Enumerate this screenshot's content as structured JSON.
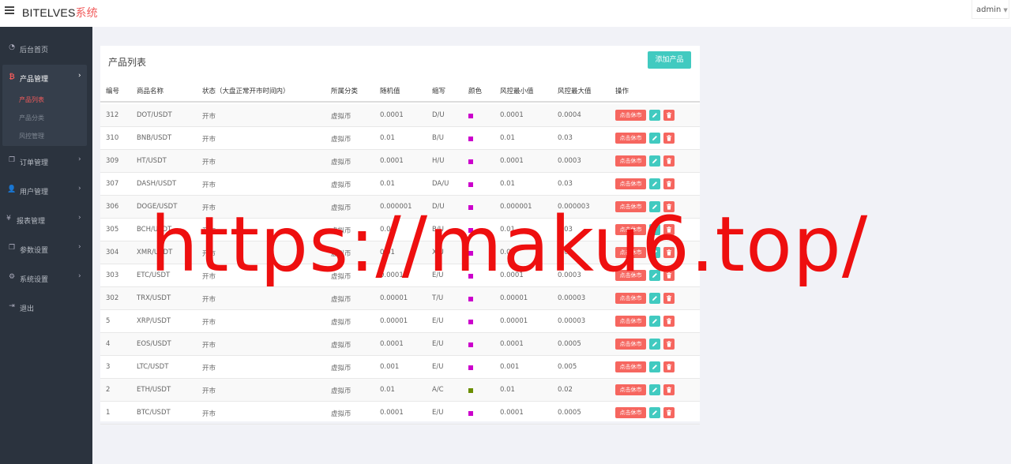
{
  "header": {
    "brand_main": "BITELVES",
    "brand_suffix": "系统",
    "user": "admin"
  },
  "sidebar": {
    "items": [
      {
        "label": "后台首页",
        "icon": "dashboard-icon"
      },
      {
        "label": "产品管理",
        "icon": "bitcoin-icon"
      },
      {
        "label": "订单管理",
        "icon": "copy-icon"
      },
      {
        "label": "用户管理",
        "icon": "user-icon"
      },
      {
        "label": "报表管理",
        "icon": "yen-icon"
      },
      {
        "label": "参数设置",
        "icon": "copy-icon"
      },
      {
        "label": "系统设置",
        "icon": "cogs-icon"
      },
      {
        "label": "退出",
        "icon": "sign-out-icon"
      }
    ],
    "sub_items": [
      {
        "label": "产品列表"
      },
      {
        "label": "产品分类"
      },
      {
        "label": "风控管理"
      }
    ]
  },
  "panel": {
    "title": "产品列表",
    "add_button": "添加产品"
  },
  "table": {
    "headers": [
      "编号",
      "商品名称",
      "状态（大盘正常开市时间内）",
      "所属分类",
      "随机值",
      "缩写",
      "颜色",
      "风控最小值",
      "风控最大值",
      "操作"
    ],
    "halt_label": "点击休市",
    "rows": [
      {
        "id": "312",
        "name": "DOT/USDT",
        "status": "开市",
        "category": "虚拟币",
        "random": "0.0001",
        "code": "D/U",
        "color": "#cc00cc",
        "min": "0.0001",
        "max": "0.0004"
      },
      {
        "id": "310",
        "name": "BNB/USDT",
        "status": "开市",
        "category": "虚拟币",
        "random": "0.01",
        "code": "B/U",
        "color": "#cc00cc",
        "min": "0.01",
        "max": "0.03"
      },
      {
        "id": "309",
        "name": "HT/USDT",
        "status": "开市",
        "category": "虚拟币",
        "random": "0.0001",
        "code": "H/U",
        "color": "#cc00cc",
        "min": "0.0001",
        "max": "0.0003"
      },
      {
        "id": "307",
        "name": "DASH/USDT",
        "status": "开市",
        "category": "虚拟币",
        "random": "0.01",
        "code": "DA/U",
        "color": "#cc00cc",
        "min": "0.01",
        "max": "0.03"
      },
      {
        "id": "306",
        "name": "DOGE/USDT",
        "status": "开市",
        "category": "虚拟币",
        "random": "0.000001",
        "code": "D/U",
        "color": "#cc00cc",
        "min": "0.000001",
        "max": "0.000003"
      },
      {
        "id": "305",
        "name": "BCH/USDT",
        "status": "开市",
        "category": "虚拟币",
        "random": "0.01",
        "code": "B/U",
        "color": "#cc00cc",
        "min": "0.01",
        "max": "0.03"
      },
      {
        "id": "304",
        "name": "XMR/USDT",
        "status": "开市",
        "category": "虚拟币",
        "random": "0.01",
        "code": "X/U",
        "color": "#cc00cc",
        "min": "0.01",
        "max": "0.03"
      },
      {
        "id": "303",
        "name": "ETC/USDT",
        "status": "开市",
        "category": "虚拟币",
        "random": "0.0001",
        "code": "E/U",
        "color": "#cc00cc",
        "min": "0.0001",
        "max": "0.0003"
      },
      {
        "id": "302",
        "name": "TRX/USDT",
        "status": "开市",
        "category": "虚拟币",
        "random": "0.00001",
        "code": "T/U",
        "color": "#cc00cc",
        "min": "0.00001",
        "max": "0.00003"
      },
      {
        "id": "5",
        "name": "XRP/USDT",
        "status": "开市",
        "category": "虚拟币",
        "random": "0.00001",
        "code": "E/U",
        "color": "#cc00cc",
        "min": "0.00001",
        "max": "0.00003"
      },
      {
        "id": "4",
        "name": "EOS/USDT",
        "status": "开市",
        "category": "虚拟币",
        "random": "0.0001",
        "code": "E/U",
        "color": "#cc00cc",
        "min": "0.0001",
        "max": "0.0005"
      },
      {
        "id": "3",
        "name": "LTC/USDT",
        "status": "开市",
        "category": "虚拟币",
        "random": "0.001",
        "code": "E/U",
        "color": "#cc00cc",
        "min": "0.001",
        "max": "0.005"
      },
      {
        "id": "2",
        "name": "ETH/USDT",
        "status": "开市",
        "category": "虚拟币",
        "random": "0.01",
        "code": "A/C",
        "color": "#6b8e00",
        "min": "0.01",
        "max": "0.02"
      },
      {
        "id": "1",
        "name": "BTC/USDT",
        "status": "开市",
        "category": "虚拟币",
        "random": "0.0001",
        "code": "E/U",
        "color": "#cc00cc",
        "min": "0.0001",
        "max": "0.0005"
      }
    ]
  },
  "watermark": "https://maku6.top/"
}
